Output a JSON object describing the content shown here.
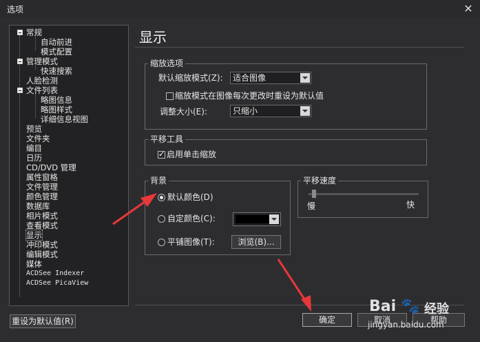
{
  "window": {
    "title": "选项",
    "close_glyph": "✕"
  },
  "tree": {
    "items": [
      {
        "label": "常规"
      },
      {
        "label": "自动前进"
      },
      {
        "label": "模式配置"
      },
      {
        "label": "管理模式"
      },
      {
        "label": "快速搜索"
      },
      {
        "label": "人脸检测"
      },
      {
        "label": "文件列表"
      },
      {
        "label": "略图信息"
      },
      {
        "label": "略图样式"
      },
      {
        "label": "详细信息视图"
      },
      {
        "label": "预览"
      },
      {
        "label": "文件夹"
      },
      {
        "label": "编目"
      },
      {
        "label": "日历"
      },
      {
        "label": "CD/DVD 管理"
      },
      {
        "label": "属性窗格"
      },
      {
        "label": "文件管理"
      },
      {
        "label": "颜色管理"
      },
      {
        "label": "数据库"
      },
      {
        "label": "相片模式"
      },
      {
        "label": "查看模式"
      },
      {
        "label": "显示"
      },
      {
        "label": "冲印模式"
      },
      {
        "label": "编辑模式"
      },
      {
        "label": "媒体"
      },
      {
        "label": "ACDSee Indexer"
      },
      {
        "label": "ACDSee PicaView"
      }
    ]
  },
  "page": {
    "title": "显示"
  },
  "zoom": {
    "group_title": "缩放选项",
    "default_mode_label": "默认缩放模式(Z):",
    "default_mode_value": "适合图像",
    "reset_mode_checkbox": "缩放模式在图像每次更改时重设为默认值",
    "resize_label": "调整大小(E):",
    "resize_value": "只缩小"
  },
  "pan": {
    "group_title": "平移工具",
    "single_click_checkbox": "启用单击缩放"
  },
  "background": {
    "group_title": "背景",
    "default_color_radio": "默认颜色(D)",
    "custom_color_radio": "自定颜色(C):",
    "custom_color_value": "#000000",
    "tile_image_radio": "平铺图像(T):",
    "browse_button": "浏览(B)..."
  },
  "pan_speed": {
    "group_title": "平移速度",
    "slow_label": "慢",
    "fast_label": "快",
    "value_fraction": 0.03
  },
  "buttons": {
    "reset_defaults": "重设为默认值(R)",
    "ok": "确定",
    "cancel": "取消",
    "help": "帮助"
  },
  "watermark": {
    "brand": "Bai",
    "brand_suffix": "经验",
    "url": "jingyan.baidu.com"
  },
  "colors": {
    "annotation_arrow": "#e8383a",
    "background": "#2d2d30"
  }
}
